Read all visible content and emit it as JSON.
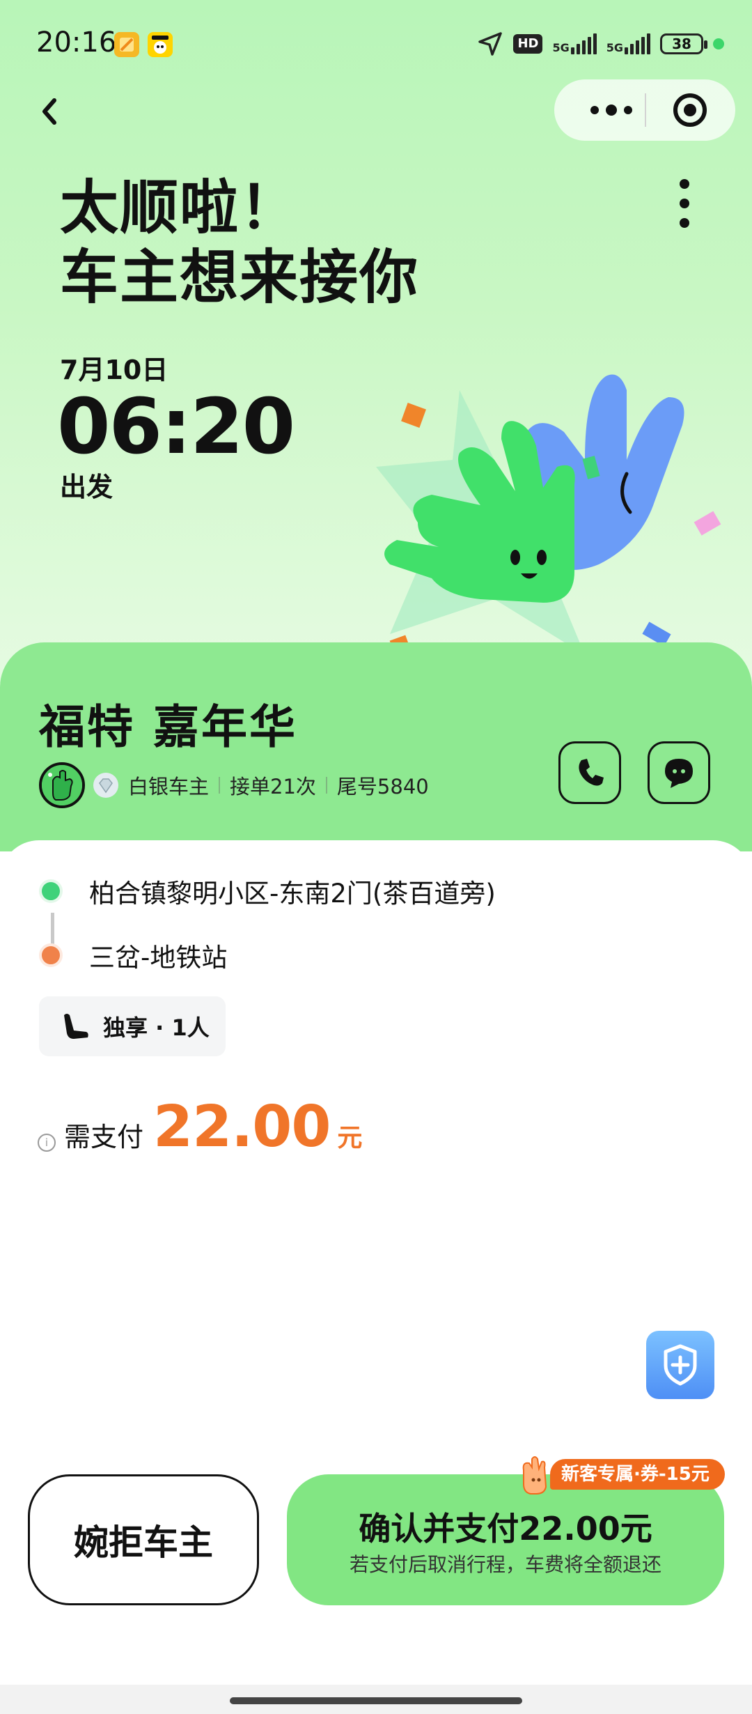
{
  "status_bar": {
    "time": "20:16",
    "network_label": "HD",
    "network_5g_1": "5G",
    "network_5g_2": "5G",
    "battery": "38",
    "icons": [
      "image-app-icon",
      "kid-app-icon",
      "location-arrow-icon",
      "signal-bars-icon",
      "battery-icon"
    ]
  },
  "nav": {
    "back_icon": "chevron-left-icon",
    "more_icon": "more-dots-icon",
    "target_icon": "target-icon",
    "kebab_icon": "kebab-icon"
  },
  "hero": {
    "headline_line1": "太顺啦！",
    "headline_line2": "车主想来接你",
    "date": "7月10日",
    "depart_time": "06:20",
    "depart_label": "出发"
  },
  "driver": {
    "car_model": "福特 嘉年华",
    "level": "白银车主",
    "orders": "接单21次",
    "plate_tail": "尾号5840",
    "actions": [
      "phone-icon",
      "chat-icon"
    ]
  },
  "trip": {
    "pickup": "柏合镇黎明小区-东南2门(茶百道旁)",
    "dropoff": "三岔-地铁站",
    "seat_type": "独享 · 1人",
    "pay_label": "需支付",
    "amount": "22.00",
    "currency": "元"
  },
  "actions": {
    "reject_label": "婉拒车主",
    "confirm_label": "确认并支付22.00元",
    "confirm_sub": "若支付后取消行程，车费将全额退还",
    "promo": "新客专属·券-15元"
  },
  "colors": {
    "hero_green": "#b8f5b8",
    "card_green": "#8ee991",
    "accent_orange": "#f07529",
    "pickup_dot": "#3fd27a",
    "dropoff_dot": "#f0824a",
    "shield_blue": "#4e8ff5"
  }
}
